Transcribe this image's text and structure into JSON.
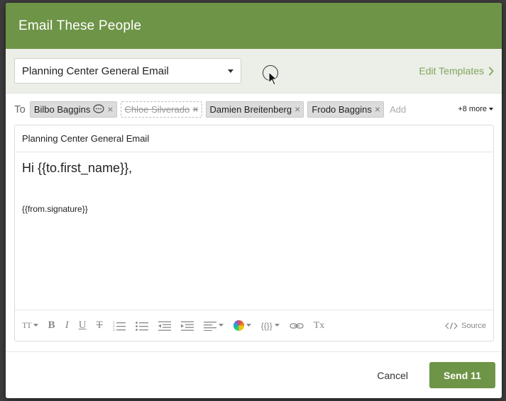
{
  "modal": {
    "title": "Email These People"
  },
  "template": {
    "selected": "Planning Center General Email",
    "edit_label": "Edit Templates"
  },
  "recipients": {
    "to_label": "To",
    "chips": [
      {
        "name": "Bilbo Baggins",
        "excluded": false,
        "has_note": true
      },
      {
        "name": "Chloe Silverado",
        "excluded": true,
        "has_note": false
      },
      {
        "name": "Damien Breitenberg",
        "excluded": false,
        "has_note": false
      },
      {
        "name": "Frodo Baggins",
        "excluded": false,
        "has_note": false
      }
    ],
    "remove_glyph": "×",
    "add_label": "Add",
    "more_label": "+8 more"
  },
  "email": {
    "subject": "Planning Center General Email",
    "greeting": "Hi {{to.first_name}},",
    "signature": "{{from.signature}}"
  },
  "toolbar": {
    "font_size_label": "TT",
    "bold": "B",
    "italic": "I",
    "underline": "U",
    "strike": "T",
    "clear_format": "Tx",
    "merge_fields": "{{}}",
    "source_label": "Source"
  },
  "footer": {
    "cancel_label": "Cancel",
    "send_label": "Send 11"
  },
  "colors": {
    "brand_green": "#6e9447",
    "link_green": "#7fa75a"
  }
}
